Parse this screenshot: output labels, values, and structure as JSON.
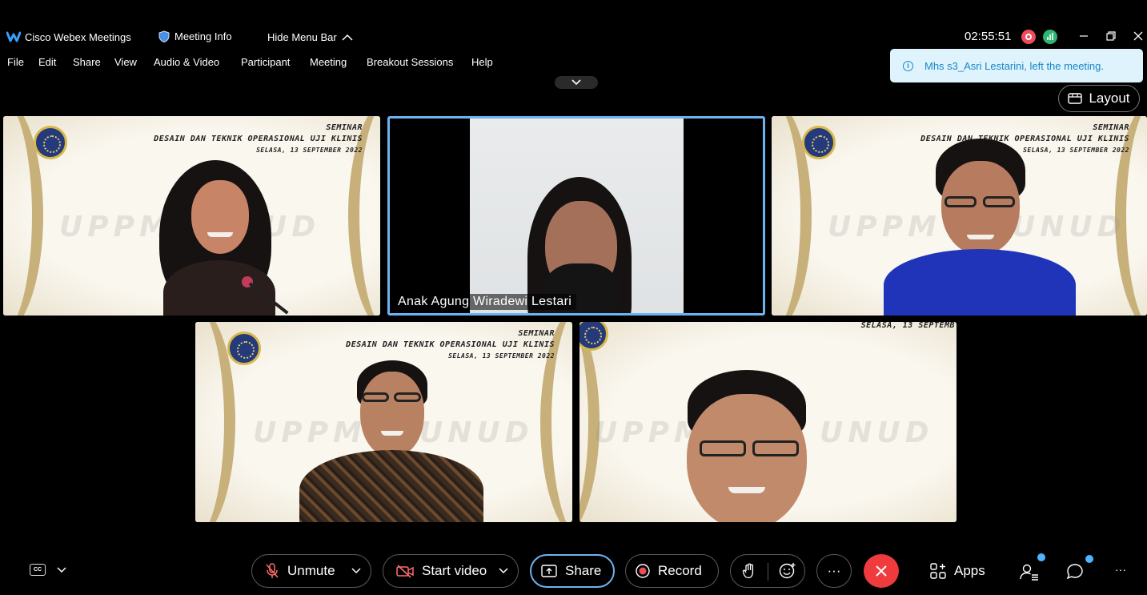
{
  "app": {
    "title": "Cisco Webex Meetings",
    "meeting_info": "Meeting Info",
    "hide_menu": "Hide Menu Bar",
    "clock": "02:55:51"
  },
  "menu": [
    "File",
    "Edit",
    "Share",
    "View",
    "Audio & Video",
    "Participant",
    "Meeting",
    "Breakout Sessions",
    "Help"
  ],
  "toast": {
    "text": "Mhs s3_Asri Lestarini, left the meeting."
  },
  "layout_label": "Layout",
  "slide": {
    "seminar": "SEMINAR",
    "title": "DESAIN DAN TEKNIK OPERASIONAL UJI KLINIS",
    "date": "SELASA, 13 SEPTEMBER 2022",
    "date_cropped": "SELASA, 13 SEPTEMB",
    "watermark_1": "UPPM F",
    "watermark_2": "UD",
    "watermark_left": "UPPM",
    "watermark_right": "UNUD"
  },
  "active_participant": "Anak Agung Wiradewi Lestari",
  "controls": {
    "unmute": "Unmute",
    "start_video": "Start video",
    "share": "Share",
    "record": "Record",
    "more": "···",
    "apps": "Apps",
    "overflow": "···"
  },
  "colors": {
    "accent": "#6db4ef",
    "end": "#ef3b3e",
    "record": "#ee4b5b",
    "toast_bg": "#dff3fd",
    "toast_fg": "#1787c5"
  }
}
